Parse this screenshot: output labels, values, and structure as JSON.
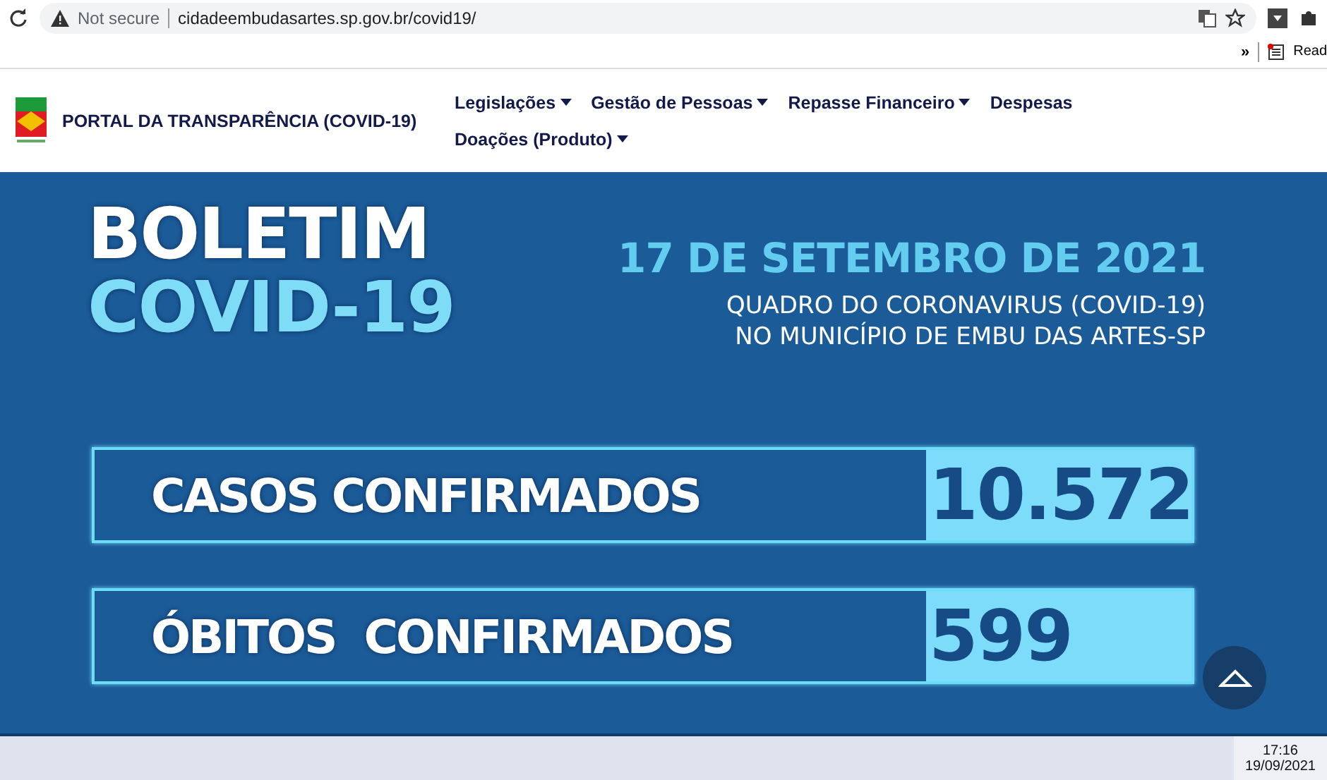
{
  "browser": {
    "security": "Not secure",
    "url": "cidadeembudasartes.sp.gov.br/covid19/",
    "overflow": "»",
    "bookmark": "Read"
  },
  "header": {
    "title": "PORTAL DA TRANSPARÊNCIA (COVID-19)",
    "nav": [
      {
        "label": "Legislações",
        "dropdown": true
      },
      {
        "label": "Gestão de Pessoas",
        "dropdown": true
      },
      {
        "label": "Repasse Financeiro",
        "dropdown": true
      },
      {
        "label": "Despesas",
        "dropdown": false
      },
      {
        "label": "Doações (Produto)",
        "dropdown": true
      }
    ]
  },
  "bulletin": {
    "title_lines": [
      "BOLETIM",
      "COVID-19"
    ],
    "date": "17 DE SETEMBRO DE 2021",
    "subtitle_lines": [
      "QUADRO DO CORONAVIRUS (COVID-19)",
      "NO MUNICÍPIO DE EMBU DAS ARTES-SP"
    ],
    "stats": [
      {
        "label": "CASOS CONFIRMADOS",
        "value": "10.572"
      },
      {
        "label": "ÓBITOS  CONFIRMADOS",
        "value": "599"
      }
    ]
  },
  "taskbar": {
    "time": "17:16",
    "date": "19/09/2021"
  }
}
